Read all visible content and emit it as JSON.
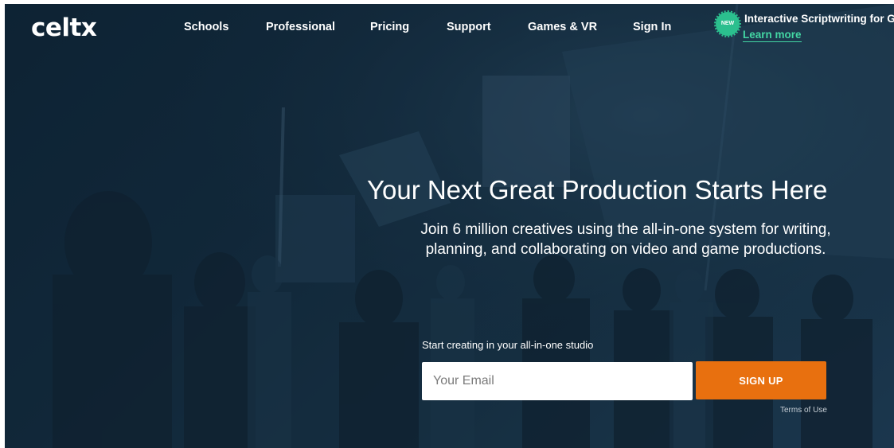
{
  "brand": {
    "logo_text": "celtx"
  },
  "nav": {
    "items": [
      {
        "label": "Schools"
      },
      {
        "label": "Professional"
      },
      {
        "label": "Pricing"
      },
      {
        "label": "Support"
      },
      {
        "label": "Games & VR"
      },
      {
        "label": "Sign In"
      }
    ]
  },
  "promo": {
    "badge": "NEW",
    "title": "Interactive Scriptwriting for G",
    "link_label": "Learn more"
  },
  "hero": {
    "headline": "Your Next Great Production Starts Here",
    "subhead": "Join 6 million creatives using the all-in-one system for writing, planning, and collaborating on video and game productions."
  },
  "signup": {
    "label": "Start creating in your all-in-one studio",
    "email_placeholder": "Your Email",
    "button_label": "SIGN UP",
    "terms_label": "Terms of Use"
  },
  "colors": {
    "accent": "#e8700f",
    "promo_green": "#2bbf8e",
    "hero_bg": "#1a3447"
  },
  "icons": {
    "badge": "new-badge-icon"
  }
}
